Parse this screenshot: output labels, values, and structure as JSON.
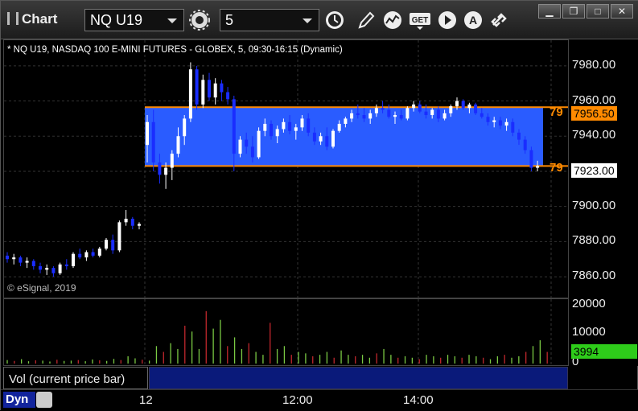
{
  "app": {
    "title": "Chart"
  },
  "toolbar": {
    "symbol": "NQ U19",
    "interval": "5"
  },
  "chart": {
    "caption": "* NQ U19, NASDAQ 100 E-MINI FUTURES - GLOBEX, 5, 09:30-16:15 (Dynamic)",
    "copyright": "© eSignal, 2019",
    "y_ticks": [
      "7980.00",
      "7960.00",
      "7940.00",
      "7920.00",
      "7900.00",
      "7880.00",
      "7860.00"
    ],
    "vol_ticks": [
      "20000",
      "10000",
      "0"
    ],
    "x_ticks": [
      "12",
      "12:00",
      "14:00"
    ],
    "upper_level": {
      "label": "79",
      "price": "7956.50"
    },
    "lower_level": {
      "label": "79",
      "price": "7923.00"
    },
    "last_volume": "3994",
    "volume_tab": "Vol (current price bar)",
    "mode": "Dyn",
    "colors": {
      "up": "#ffffff",
      "down": "#1a2dff",
      "band": "#2a5cff",
      "level": "#ff8a00",
      "vol_up": "#7ac943",
      "vol_down": "#c1272d"
    }
  },
  "chart_data": {
    "type": "candlestick",
    "ylim": [
      7855,
      7990
    ],
    "upper_band": 7956.5,
    "lower_band": 7923.0,
    "series": [
      {
        "name": "price",
        "values": [
          [
            7872,
            7874,
            7868,
            7870
          ],
          [
            7870,
            7873,
            7867,
            7871
          ],
          [
            7871,
            7872,
            7866,
            7868
          ],
          [
            7868,
            7871,
            7865,
            7869
          ],
          [
            7869,
            7870,
            7864,
            7866
          ],
          [
            7866,
            7868,
            7862,
            7864
          ],
          [
            7864,
            7867,
            7861,
            7865
          ],
          [
            7865,
            7866,
            7860,
            7862
          ],
          [
            7862,
            7868,
            7861,
            7867
          ],
          [
            7867,
            7870,
            7864,
            7866
          ],
          [
            7866,
            7874,
            7865,
            7873
          ],
          [
            7873,
            7876,
            7870,
            7871
          ],
          [
            7871,
            7875,
            7869,
            7874
          ],
          [
            7874,
            7876,
            7871,
            7872
          ],
          [
            7872,
            7877,
            7871,
            7876
          ],
          [
            7876,
            7882,
            7875,
            7881
          ],
          [
            7881,
            7884,
            7873,
            7875
          ],
          [
            7875,
            7892,
            7874,
            7891
          ],
          [
            7891,
            7898,
            7889,
            7893
          ],
          [
            7893,
            7894,
            7887,
            7889
          ],
          [
            7889,
            7891,
            7887,
            7890
          ]
        ]
      },
      {
        "name": "session",
        "values": [
          [
            7935,
            7952,
            7925,
            7948
          ],
          [
            7948,
            7955,
            7920,
            7925
          ],
          [
            7925,
            7930,
            7913,
            7918
          ],
          [
            7918,
            7925,
            7910,
            7922
          ],
          [
            7922,
            7932,
            7915,
            7930
          ],
          [
            7930,
            7945,
            7928,
            7940
          ],
          [
            7940,
            7952,
            7935,
            7950
          ],
          [
            7950,
            7982,
            7948,
            7978
          ],
          [
            7978,
            7980,
            7955,
            7958
          ],
          [
            7958,
            7975,
            7956,
            7972
          ],
          [
            7972,
            7976,
            7960,
            7962
          ],
          [
            7962,
            7973,
            7958,
            7970
          ],
          [
            7970,
            7972,
            7960,
            7965
          ],
          [
            7965,
            7968,
            7958,
            7961
          ],
          [
            7961,
            7963,
            7920,
            7930
          ],
          [
            7930,
            7940,
            7928,
            7938
          ],
          [
            7938,
            7942,
            7930,
            7934
          ],
          [
            7934,
            7940,
            7925,
            7928
          ],
          [
            7928,
            7945,
            7927,
            7943
          ],
          [
            7943,
            7950,
            7940,
            7947
          ],
          [
            7947,
            7949,
            7938,
            7940
          ],
          [
            7940,
            7946,
            7936,
            7944
          ],
          [
            7944,
            7950,
            7942,
            7948
          ],
          [
            7948,
            7952,
            7941,
            7943
          ],
          [
            7943,
            7947,
            7938,
            7945
          ],
          [
            7945,
            7952,
            7943,
            7950
          ],
          [
            7950,
            7953,
            7940,
            7942
          ],
          [
            7942,
            7945,
            7935,
            7937
          ],
          [
            7937,
            7942,
            7935,
            7940
          ],
          [
            7940,
            7945,
            7932,
            7934
          ],
          [
            7934,
            7944,
            7933,
            7943
          ],
          [
            7943,
            7949,
            7942,
            7947
          ],
          [
            7947,
            7951,
            7945,
            7950
          ],
          [
            7950,
            7955,
            7948,
            7953
          ],
          [
            7953,
            7958,
            7950,
            7952
          ],
          [
            7952,
            7956,
            7948,
            7950
          ],
          [
            7950,
            7955,
            7947,
            7953
          ],
          [
            7953,
            7958,
            7951,
            7956
          ],
          [
            7956,
            7960,
            7953,
            7955
          ],
          [
            7955,
            7958,
            7950,
            7951
          ],
          [
            7951,
            7954,
            7947,
            7952
          ],
          [
            7952,
            7955,
            7949,
            7950
          ],
          [
            7950,
            7957,
            7949,
            7956
          ],
          [
            7956,
            7960,
            7954,
            7958
          ],
          [
            7958,
            7960,
            7953,
            7954
          ],
          [
            7954,
            7958,
            7950,
            7952
          ],
          [
            7952,
            7956,
            7950,
            7955
          ],
          [
            7955,
            7957,
            7948,
            7950
          ],
          [
            7950,
            7955,
            7949,
            7953
          ],
          [
            7953,
            7958,
            7951,
            7957
          ],
          [
            7957,
            7962,
            7955,
            7960
          ],
          [
            7960,
            7961,
            7955,
            7956
          ],
          [
            7956,
            7959,
            7953,
            7958
          ],
          [
            7958,
            7959,
            7952,
            7953
          ],
          [
            7953,
            7956,
            7950,
            7951
          ],
          [
            7951,
            7953,
            7946,
            7948
          ],
          [
            7948,
            7951,
            7945,
            7949
          ],
          [
            7949,
            7951,
            7944,
            7946
          ],
          [
            7946,
            7950,
            7943,
            7948
          ],
          [
            7948,
            7950,
            7940,
            7942
          ],
          [
            7942,
            7944,
            7935,
            7938
          ],
          [
            7938,
            7940,
            7930,
            7932
          ],
          [
            7932,
            7934,
            7920,
            7922
          ],
          [
            7922,
            7926,
            7920,
            7923
          ]
        ]
      }
    ],
    "volume": [
      1200,
      900,
      1500,
      800,
      1100,
      1000,
      700,
      1300,
      900,
      1000,
      1200,
      800,
      1400,
      1100,
      900,
      1600,
      1200,
      2500,
      1800,
      1300,
      1000,
      6000,
      4000,
      7000,
      5000,
      13000,
      11000,
      5000,
      18000,
      12000,
      15000,
      6000,
      9000,
      5000,
      7000,
      4000,
      3000,
      14000,
      5000,
      6000,
      3000,
      4000,
      3500,
      2500,
      3000,
      4000,
      2000,
      4500,
      3000,
      2500,
      3000,
      2000,
      3500,
      5000,
      3000,
      2000,
      2500,
      2000,
      1500,
      3000,
      2500,
      2000,
      3000,
      2500,
      2000,
      3000,
      2500,
      2000,
      1500,
      2500,
      3000,
      2000,
      2500,
      4000,
      6000,
      8000,
      3994
    ],
    "volume_ylim": [
      0,
      21000
    ]
  }
}
